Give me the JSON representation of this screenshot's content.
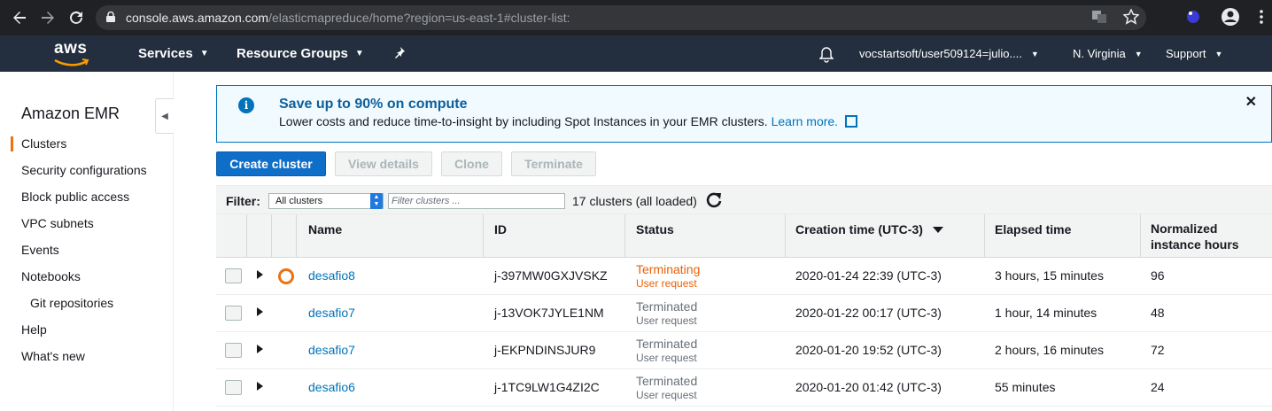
{
  "browser": {
    "url_host": "console.aws.amazon.com",
    "url_path": "/elasticmapreduce/home?region=us-east-1#cluster-list:"
  },
  "aws_nav": {
    "logo_text": "aws",
    "services": "Services",
    "resource_groups": "Resource Groups",
    "account": "vocstartsoft/user509124=julio....",
    "region": "N. Virginia",
    "support": "Support"
  },
  "sidebar": {
    "title": "Amazon EMR",
    "items": [
      {
        "label": "Clusters",
        "active": true
      },
      {
        "label": "Security configurations"
      },
      {
        "label": "Block public access"
      },
      {
        "label": "VPC subnets"
      },
      {
        "label": "Events"
      },
      {
        "label": "Notebooks"
      },
      {
        "label": "Git repositories",
        "sub": true
      },
      {
        "label": "Help"
      },
      {
        "label": "What's new"
      }
    ]
  },
  "banner": {
    "title": "Save up to 90% on compute",
    "body": "Lower costs and reduce time-to-insight by including Spot Instances in your EMR clusters. ",
    "link": "Learn more."
  },
  "toolbar": {
    "create": "Create cluster",
    "view_details": "View details",
    "clone": "Clone",
    "terminate": "Terminate"
  },
  "filter": {
    "label": "Filter:",
    "selected": "All clusters",
    "placeholder": "Filter clusters ...",
    "count": "17 clusters (all loaded)"
  },
  "table": {
    "headers": {
      "name": "Name",
      "id": "ID",
      "status": "Status",
      "creation": "Creation time (UTC-3)",
      "elapsed": "Elapsed time",
      "hours_line1": "Normalized",
      "hours_line2": "instance hours"
    },
    "rows": [
      {
        "name": "desafio8",
        "id": "j-397MW0GXJVSKZ",
        "status": "Terminating",
        "reason": "User request",
        "created": "2020-01-24 22:39 (UTC-3)",
        "elapsed": "3 hours, 15 minutes",
        "hours": "96"
      },
      {
        "name": "desafio7",
        "id": "j-13VOK7JYLE1NM",
        "status": "Terminated",
        "reason": "User request",
        "created": "2020-01-22 00:17 (UTC-3)",
        "elapsed": "1 hour, 14 minutes",
        "hours": "48"
      },
      {
        "name": "desafio7",
        "id": "j-EKPNDINSJUR9",
        "status": "Terminated",
        "reason": "User request",
        "created": "2020-01-20 19:52 (UTC-3)",
        "elapsed": "2 hours, 16 minutes",
        "hours": "72"
      },
      {
        "name": "desafio6",
        "id": "j-1TC9LW1G4ZI2C",
        "status": "Terminated",
        "reason": "User request",
        "created": "2020-01-20 01:42 (UTC-3)",
        "elapsed": "55 minutes",
        "hours": "24"
      }
    ]
  }
}
